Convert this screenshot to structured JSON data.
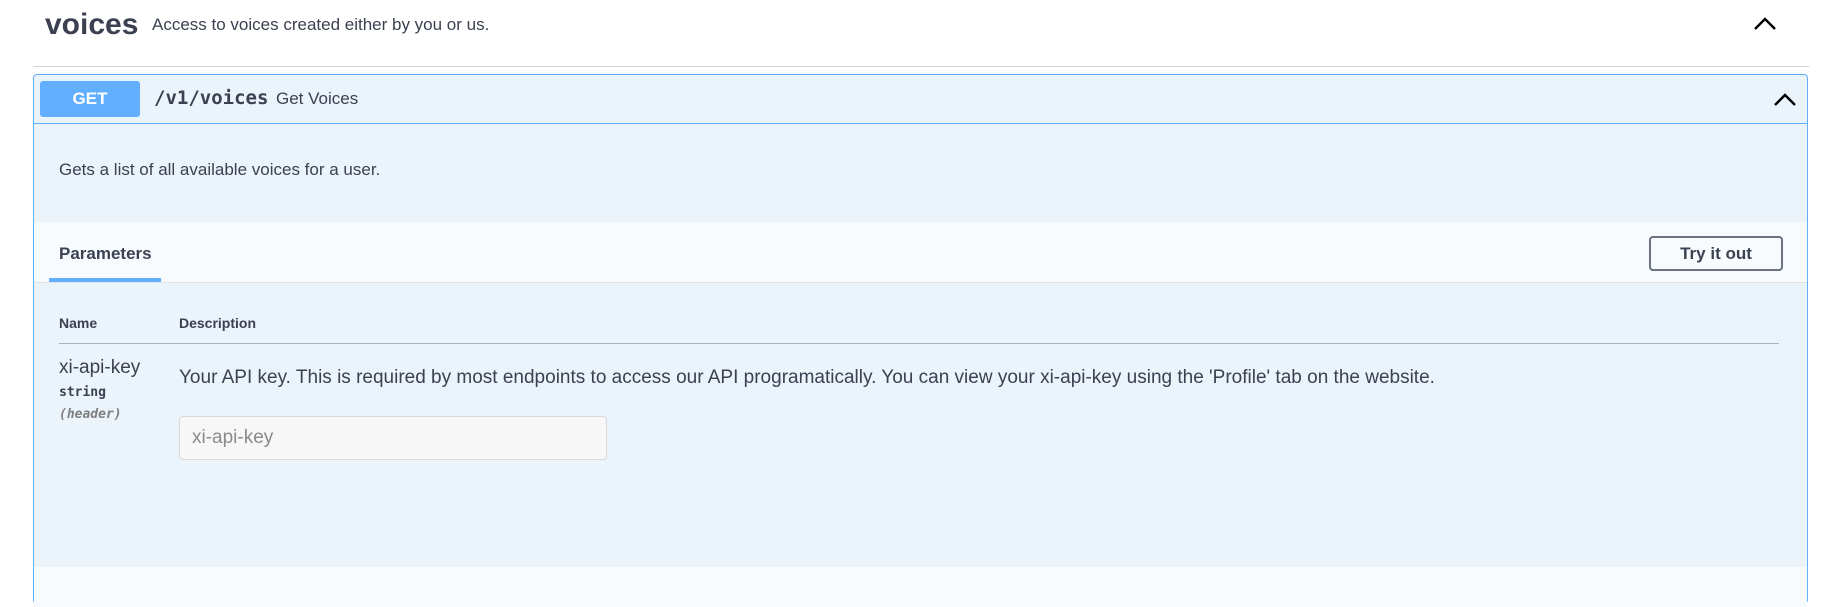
{
  "tag": {
    "name": "voices",
    "description": "Access to voices created either by you or us.",
    "toggle_icon": "chevron-up-icon"
  },
  "operation": {
    "method": "GET",
    "path": "/v1/voices",
    "summary": "Get Voices",
    "description": "Gets a list of all available voices for a user.",
    "method_color": "#61affe",
    "toggle_icon": "chevron-up-icon"
  },
  "parameters_section": {
    "tab_label": "Parameters",
    "try_button_label": "Try it out",
    "columns": [
      "Name",
      "Description"
    ],
    "params": [
      {
        "name": "xi-api-key",
        "type": "string",
        "in": "(header)",
        "description": "Your API key. This is required by most endpoints to access our API programatically. You can view your xi-api-key using the 'Profile' tab on the website.",
        "placeholder": "xi-api-key"
      }
    ]
  }
}
